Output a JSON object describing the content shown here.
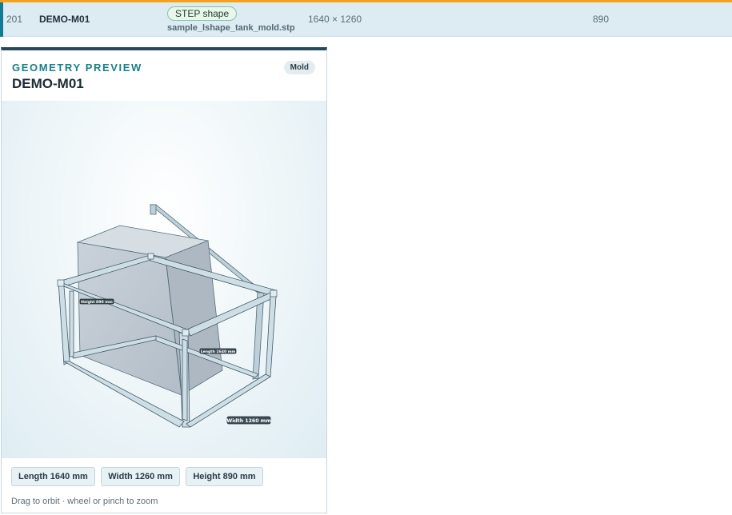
{
  "row": {
    "index": "201",
    "name": "DEMO-M01",
    "badge": "STEP shape",
    "file": "sample_lshape_tank_mold.stp",
    "dimensions": "1640 × 1260",
    "value": "890"
  },
  "card": {
    "kicker": "GEOMETRY PREVIEW",
    "title": "DEMO-M01",
    "tag": "Mold",
    "labels": {
      "height": "Height 890 mm",
      "length": "Length 1640 mm",
      "width": "Width 1260 mm"
    },
    "chips": {
      "length": "Length 1640 mm",
      "width": "Width 1260 mm",
      "height": "Height 890 mm"
    },
    "hint": "Drag to orbit · wheel or pinch to zoom"
  },
  "colors": {
    "accent_orange": "#f5a11c",
    "row_bg": "#dcecf2",
    "kicker_teal": "#167f8c",
    "card_border_top": "#26495c"
  }
}
